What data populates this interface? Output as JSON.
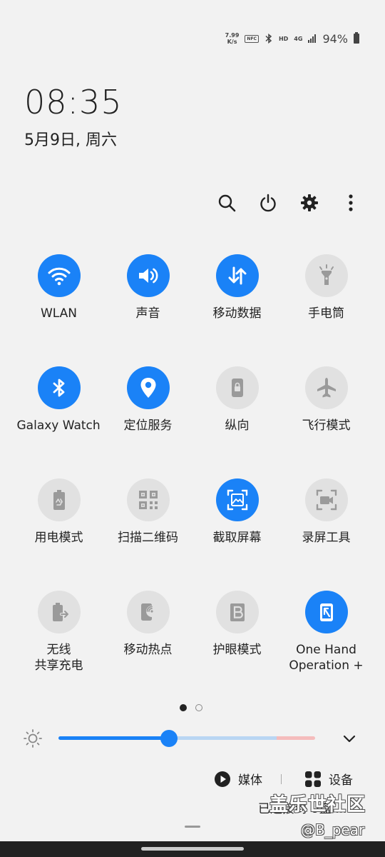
{
  "status_bar": {
    "net_speed_value": "7.99",
    "net_speed_unit": "K/s",
    "nfc": "NFC",
    "hd": "HD",
    "network": "4G",
    "battery": "94%"
  },
  "clock": {
    "time": "08:35",
    "date": "5月9日, 周六"
  },
  "toolbar": {
    "icons": [
      "search-icon",
      "power-icon",
      "gear-icon",
      "more-vert-icon"
    ]
  },
  "tiles": [
    {
      "label": "WLAN",
      "icon": "wifi-icon",
      "state": "on"
    },
    {
      "label": "声音",
      "icon": "volume-icon",
      "state": "on"
    },
    {
      "label": "移动数据",
      "icon": "data-arrows-icon",
      "state": "on"
    },
    {
      "label": "手电筒",
      "icon": "flashlight-icon",
      "state": "off"
    },
    {
      "label": "Galaxy Watch",
      "icon": "bluetooth-icon",
      "state": "on"
    },
    {
      "label": "定位服务",
      "icon": "location-pin-icon",
      "state": "on"
    },
    {
      "label": "纵向",
      "icon": "portrait-lock-icon",
      "state": "off"
    },
    {
      "label": "飞行模式",
      "icon": "airplane-icon",
      "state": "off"
    },
    {
      "label": "用电模式",
      "icon": "battery-recycle-icon",
      "state": "off"
    },
    {
      "label": "扫描二维码",
      "icon": "qr-code-icon",
      "state": "off"
    },
    {
      "label": "截取屏幕",
      "icon": "screenshot-icon",
      "state": "on"
    },
    {
      "label": "录屏工具",
      "icon": "screen-record-icon",
      "state": "off"
    },
    {
      "label_line1": "无线",
      "label_line2": "共享充电",
      "icon": "wireless-share-icon",
      "state": "off"
    },
    {
      "label": "移动热点",
      "icon": "hotspot-icon",
      "state": "off"
    },
    {
      "label": "护眼模式",
      "icon": "eye-comfort-icon",
      "state": "off"
    },
    {
      "label_line1": "One Hand",
      "label_line2": "Operation +",
      "icon": "one-hand-icon",
      "state": "on"
    }
  ],
  "pager": {
    "pages": 2,
    "current": 1
  },
  "brightness": {
    "level": 0.43
  },
  "media": {
    "media_label": "媒体",
    "devices_label": "设备"
  },
  "connected": "已连接到 U盘 ...",
  "watermark": {
    "line1": "盖乐世社区",
    "line2": "@B_pear"
  },
  "colors": {
    "accent": "#1a82f7",
    "tile_off": "#e1e1e1",
    "background": "#f2f2f2"
  }
}
